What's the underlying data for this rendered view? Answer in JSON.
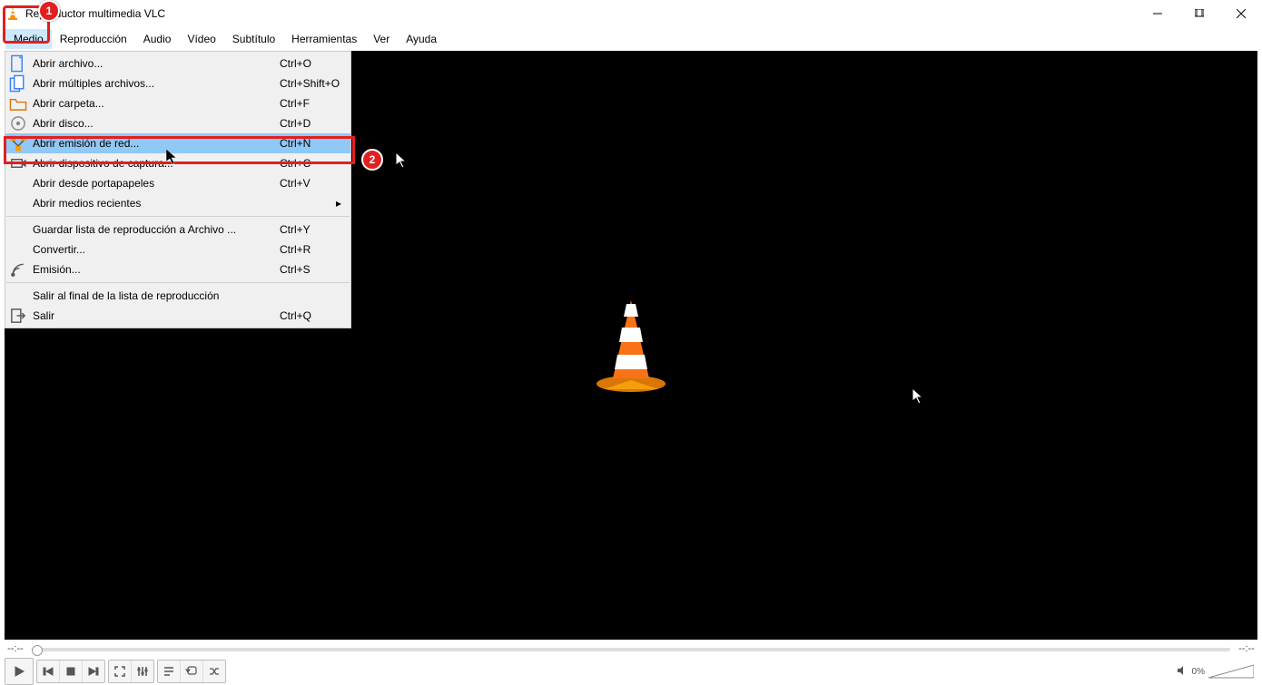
{
  "window": {
    "title": "Reproductor multimedia VLC"
  },
  "menubar": {
    "items": [
      "Medio",
      "Reproducción",
      "Audio",
      "Vídeo",
      "Subtítulo",
      "Herramientas",
      "Ver",
      "Ayuda"
    ],
    "active_index": 0
  },
  "dropdown": {
    "groups": [
      [
        {
          "icon": "file-icon",
          "label": "Abrir archivo...",
          "shortcut": "Ctrl+O"
        },
        {
          "icon": "files-icon",
          "label": "Abrir múltiples archivos...",
          "shortcut": "Ctrl+Shift+O"
        },
        {
          "icon": "folder-icon",
          "label": "Abrir carpeta...",
          "shortcut": "Ctrl+F"
        },
        {
          "icon": "disc-icon",
          "label": "Abrir disco...",
          "shortcut": "Ctrl+D"
        },
        {
          "icon": "network-icon",
          "label": "Abrir emisión de red...",
          "shortcut": "Ctrl+N",
          "hover": true
        },
        {
          "icon": "capture-icon",
          "label": "Abrir dispositivo de captura...",
          "shortcut": "Ctrl+C"
        },
        {
          "icon": "",
          "label": "Abrir desde portapapeles",
          "shortcut": "Ctrl+V"
        },
        {
          "icon": "",
          "label": "Abrir medios recientes",
          "shortcut": "",
          "submenu": true
        }
      ],
      [
        {
          "icon": "",
          "label": "Guardar lista de reproducción a Archivo ...",
          "shortcut": "Ctrl+Y"
        },
        {
          "icon": "",
          "label": "Convertir...",
          "shortcut": "Ctrl+R"
        },
        {
          "icon": "stream-icon",
          "label": "Emisión...",
          "shortcut": "Ctrl+S"
        }
      ],
      [
        {
          "icon": "",
          "label": "Salir al final de la lista de reproducción",
          "shortcut": ""
        },
        {
          "icon": "quit-icon",
          "label": "Salir",
          "shortcut": "Ctrl+Q"
        }
      ]
    ]
  },
  "playback": {
    "time_start": "--:--",
    "time_end": "--:--",
    "volume_pct": "0%"
  },
  "annotations": {
    "badge1": "1",
    "badge2": "2"
  }
}
